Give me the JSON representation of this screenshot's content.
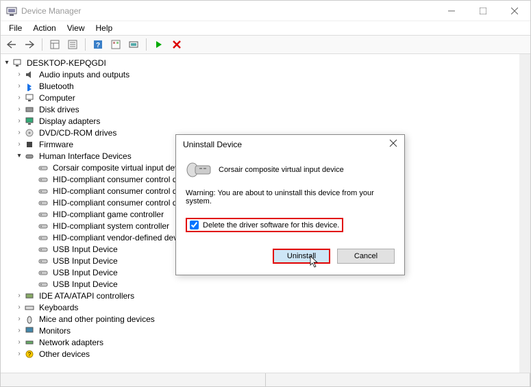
{
  "titlebar": {
    "title": "Device Manager"
  },
  "menubar": {
    "items": [
      "File",
      "Action",
      "View",
      "Help"
    ]
  },
  "tree": {
    "root": "DESKTOP-KEPQGDI",
    "categories": [
      {
        "label": "Audio inputs and outputs",
        "expanded": false
      },
      {
        "label": "Bluetooth",
        "expanded": false
      },
      {
        "label": "Computer",
        "expanded": false
      },
      {
        "label": "Disk drives",
        "expanded": false
      },
      {
        "label": "Display adapters",
        "expanded": false
      },
      {
        "label": "DVD/CD-ROM drives",
        "expanded": false
      },
      {
        "label": "Firmware",
        "expanded": false
      },
      {
        "label": "Human Interface Devices",
        "expanded": true,
        "children": [
          "Corsair composite virtual input device",
          "HID-compliant consumer control device",
          "HID-compliant consumer control device",
          "HID-compliant consumer control device",
          "HID-compliant game controller",
          "HID-compliant system controller",
          "HID-compliant vendor-defined device",
          "USB Input Device",
          "USB Input Device",
          "USB Input Device",
          "USB Input Device"
        ]
      },
      {
        "label": "IDE ATA/ATAPI controllers",
        "expanded": false
      },
      {
        "label": "Keyboards",
        "expanded": false
      },
      {
        "label": "Mice and other pointing devices",
        "expanded": false
      },
      {
        "label": "Monitors",
        "expanded": false
      },
      {
        "label": "Network adapters",
        "expanded": false
      },
      {
        "label": "Other devices",
        "expanded": false
      }
    ]
  },
  "dialog": {
    "title": "Uninstall Device",
    "device_name": "Corsair composite virtual input device",
    "warning": "Warning: You are about to uninstall this device from your system.",
    "checkbox_label": "Delete the driver software for this device.",
    "uninstall_label": "Uninstall",
    "cancel_label": "Cancel"
  }
}
